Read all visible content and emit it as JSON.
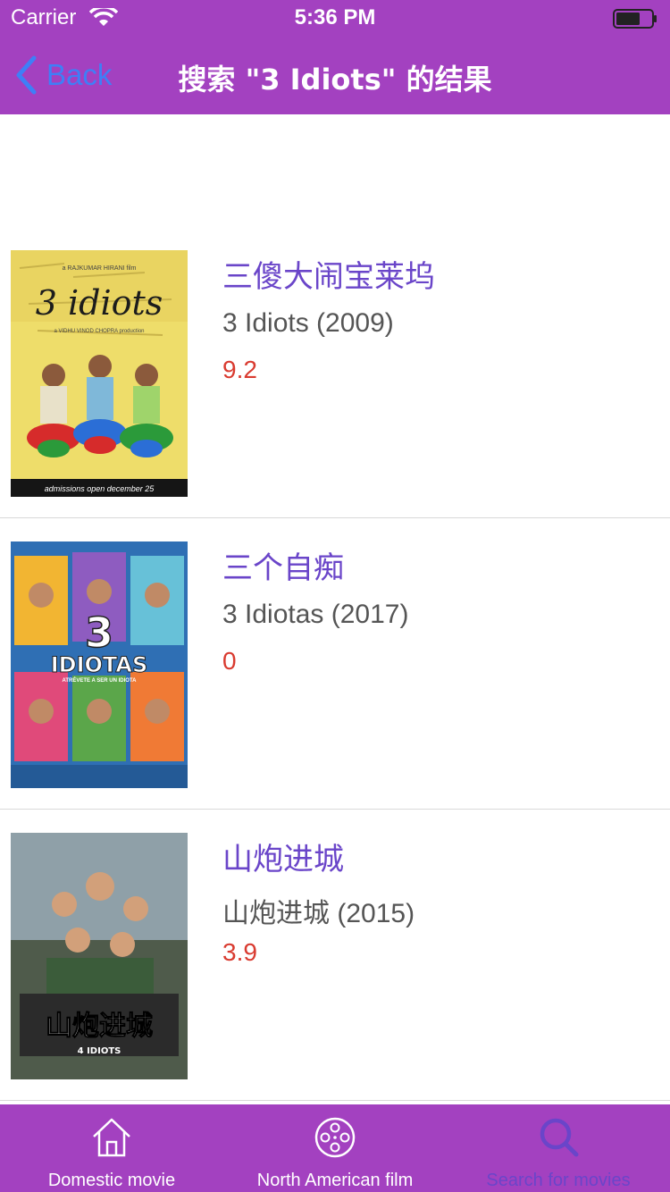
{
  "status_bar": {
    "carrier": "Carrier",
    "time": "5:36 PM"
  },
  "nav": {
    "back_label": "Back",
    "title": "搜索 \"3 Idiots\" 的结果"
  },
  "results": [
    {
      "title_cn": "三傻大闹宝莱坞",
      "title_en": "3 Idiots (2009)",
      "score": "9.2",
      "poster_text": {
        "director": "a RAJKUMAR HIRANI film",
        "title": "3 idiots",
        "producer": "a VIDHU VINOD CHOPRA production",
        "tagline": "admissions open december 25"
      }
    },
    {
      "title_cn": "三个自痴",
      "title_en": "3 Idiotas (2017)",
      "score": "0",
      "poster_text": {
        "title": "IDIOTAS",
        "number": "3",
        "tagline": "ATRÉVETE A SER UN IDIOTA"
      }
    },
    {
      "title_cn": "山炮进城",
      "title_en": "山炮进城 (2015)",
      "score": "3.9",
      "poster_text": {
        "title": "山炮进城",
        "subtitle": "4 IDIOTS"
      }
    }
  ],
  "tabs": [
    {
      "label": "Domestic movie",
      "icon": "home-icon",
      "active": false
    },
    {
      "label": "North American film",
      "icon": "film-reel-icon",
      "active": false
    },
    {
      "label": "Search for movies",
      "icon": "search-icon",
      "active": true
    }
  ],
  "colors": {
    "header": "#a341c0",
    "accent": "#6a45c9",
    "back": "#3e7ff7",
    "score": "#d93b30"
  }
}
